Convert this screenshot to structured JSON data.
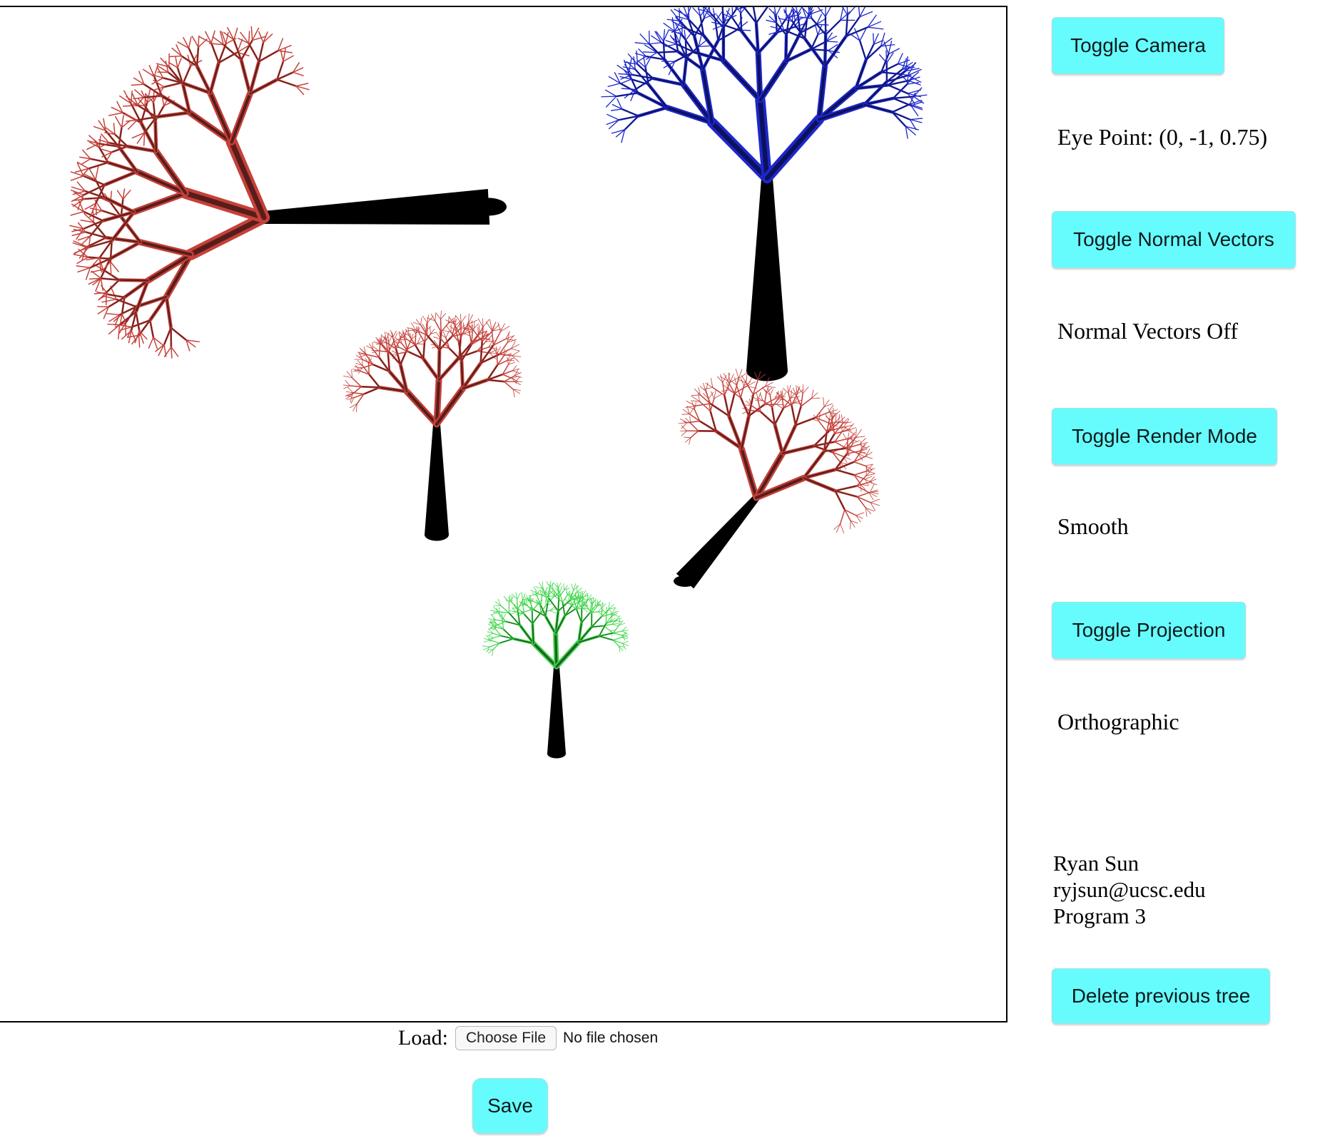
{
  "controls": {
    "toggle_camera": "Toggle Camera",
    "eye_point_label": "Eye Point: (0, -1, 0.75)",
    "toggle_normals": "Toggle Normal Vectors",
    "normals_status": "Normal Vectors Off",
    "toggle_render_mode": "Toggle Render Mode",
    "render_mode_status": "Smooth",
    "toggle_projection": "Toggle Projection",
    "projection_status": "Orthographic",
    "delete_tree": "Delete previous tree"
  },
  "credits": {
    "name": "Ryan Sun",
    "email": "ryjsun@ucsc.edu",
    "program": "Program 3"
  },
  "file_input": {
    "label": "Load:",
    "button_label": "Choose File",
    "status": "No file chosen"
  },
  "save_label": "Save",
  "colors": {
    "button_bg": "#66fcfd",
    "trunk": "#000000",
    "red_tree": "#c4413a",
    "blue_tree": "#1d27c9",
    "green_tree": "#3fd44a"
  },
  "scene": {
    "trees": [
      {
        "id": "tree-red-sideways",
        "color": "red"
      },
      {
        "id": "tree-blue-tall",
        "color": "blue"
      },
      {
        "id": "tree-red-middle",
        "color": "red"
      },
      {
        "id": "tree-red-tilted",
        "color": "red"
      },
      {
        "id": "tree-green-small",
        "color": "green"
      }
    ]
  }
}
